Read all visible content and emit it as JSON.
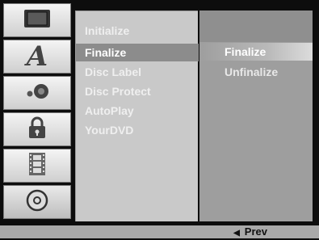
{
  "sidebar": {
    "icons": [
      {
        "name": "screen-icon"
      },
      {
        "name": "language-icon",
        "glyph": "A"
      },
      {
        "name": "audio-icon"
      },
      {
        "name": "lock-icon"
      },
      {
        "name": "film-icon"
      },
      {
        "name": "disc-icon"
      }
    ]
  },
  "menu": {
    "items": [
      "Initialize",
      "Finalize",
      "Disc Label",
      "Disc Protect",
      "AutoPlay",
      "YourDVD"
    ]
  },
  "options": {
    "items": [
      "Finalize",
      "Unfinalize"
    ]
  },
  "footer": {
    "prev_label": "Prev"
  }
}
